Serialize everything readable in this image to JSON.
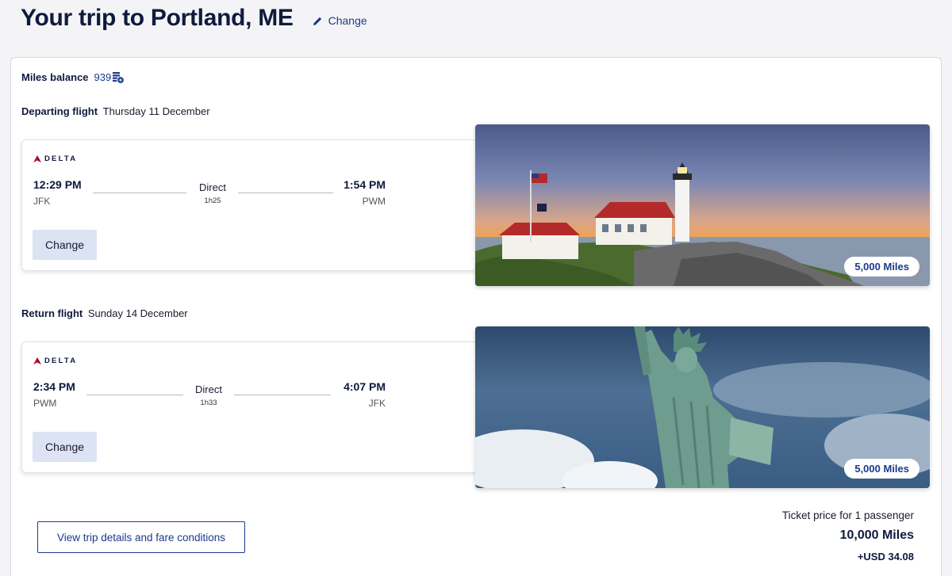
{
  "header": {
    "title": "Your trip to Portland, ME",
    "edit_label": "Change"
  },
  "miles_balance": {
    "label": "Miles balance",
    "value": "939"
  },
  "departing": {
    "label": "Departing flight",
    "date": "Thursday 11 December",
    "airline": "DELTA",
    "depart_time": "12:29 PM",
    "depart_code": "JFK",
    "stops": "Direct",
    "duration": "1h25",
    "arrive_time": "1:54 PM",
    "arrive_code": "PWM",
    "change_label": "Change",
    "miles": "5,000 Miles"
  },
  "return": {
    "label": "Return flight",
    "date": "Sunday 14 December",
    "airline": "DELTA",
    "depart_time": "2:34 PM",
    "depart_code": "PWM",
    "stops": "Direct",
    "duration": "1h33",
    "arrive_time": "4:07 PM",
    "arrive_code": "JFK",
    "change_label": "Change",
    "miles": "5,000 Miles"
  },
  "footer": {
    "details_label": "View trip details and fare conditions",
    "ticket_label": "Ticket price for 1 passenger",
    "total_miles": "10,000 Miles",
    "total_usd": "+USD 34.08"
  },
  "colors": {
    "brand_navy": "#0f1a3d",
    "link_blue": "#1b3a8c",
    "button_bg": "#dce3f2",
    "delta_red": "#c8102e"
  }
}
